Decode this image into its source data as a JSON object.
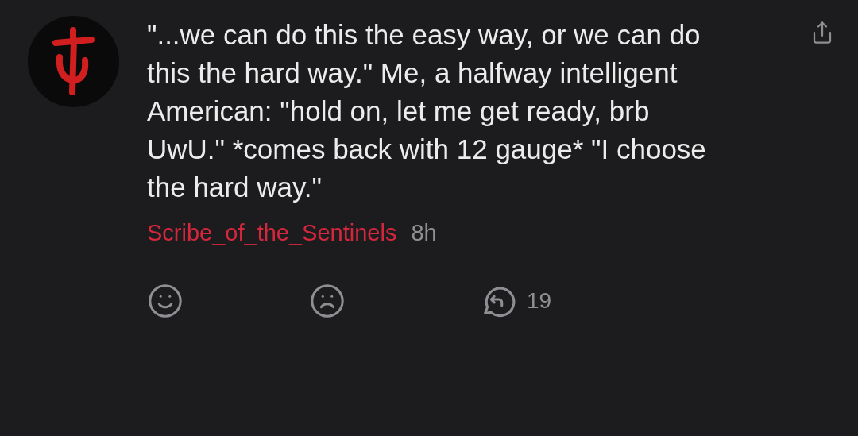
{
  "comment": {
    "text": "\"...we can do this the easy way, or we can do this the hard way.\" Me, a halfway intelligent American: \"hold on, let me get ready, brb UwU.\" *comes back with 12 gauge* \"I choose the hard way.\"",
    "author": "Scribe_of_the_Sentinels",
    "time": "8h"
  },
  "actions": {
    "reply_count": "19"
  }
}
